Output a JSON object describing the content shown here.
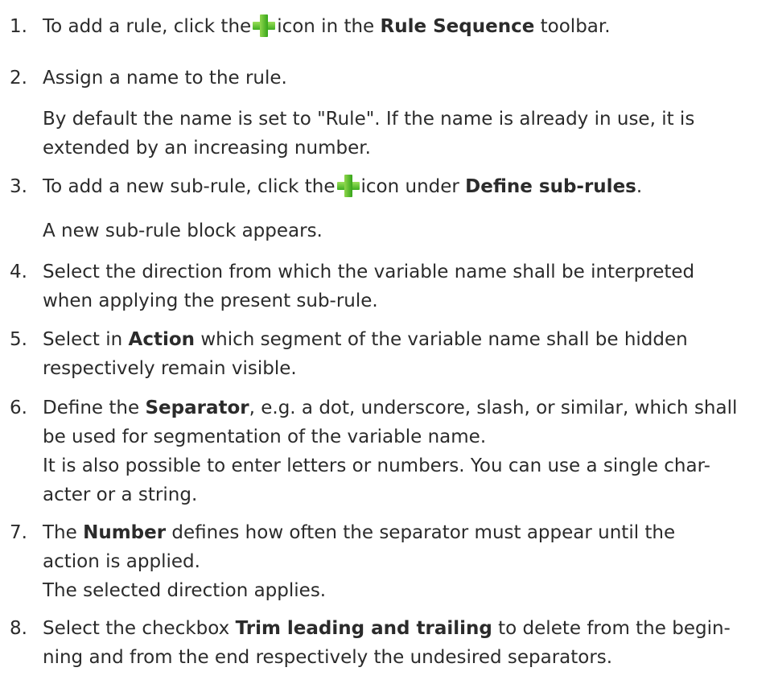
{
  "steps": [
    {
      "number": "1.",
      "t1": "To add a rule, click the",
      "icon": "plus-icon",
      "t2": "icon in the",
      "b1": "Rule Sequence",
      "t3": "toolbar."
    },
    {
      "number": "2.",
      "line1": "Assign a name to the rule.",
      "note_line1": "By default the name is set to \"Rule\". If the name is already in use, it is",
      "note_line2": "extended by an increasing number."
    },
    {
      "number": "3.",
      "t1": "To add a new sub-rule, click the",
      "icon": "plus-icon",
      "t2": "icon under",
      "b1": "Define sub-rules",
      "t3": ".",
      "note_line1": "A new sub-rule block appears."
    },
    {
      "number": "4.",
      "line1": "Select the direction from which the variable name shall be interpreted",
      "line2": "when applying the present sub-rule."
    },
    {
      "number": "5.",
      "t1": "Select in",
      "b1": "Action",
      "t2": "which segment of the variable name shall be hidden",
      "line2": "respectively remain visible."
    },
    {
      "number": "6.",
      "t1": "Define the",
      "b1": "Separator",
      "t2": ", e.g. a dot, underscore, slash, or similar, which shall",
      "line2": "be used for segmentation of the variable name.",
      "line3": "It is also possible to enter letters or numbers. You can use a single char-",
      "line4": "acter or a string."
    },
    {
      "number": "7.",
      "t1": "The",
      "b1": "Number",
      "t2": "defines how often the separator must appear until the",
      "line2": "action is applied.",
      "line3": "The selected direction applies."
    },
    {
      "number": "8.",
      "t1": "Select the checkbox",
      "b1": "Trim leading and trailing",
      "t2": "to delete from the begin-",
      "line2": "ning and from the end respectively the undesired separators."
    }
  ]
}
